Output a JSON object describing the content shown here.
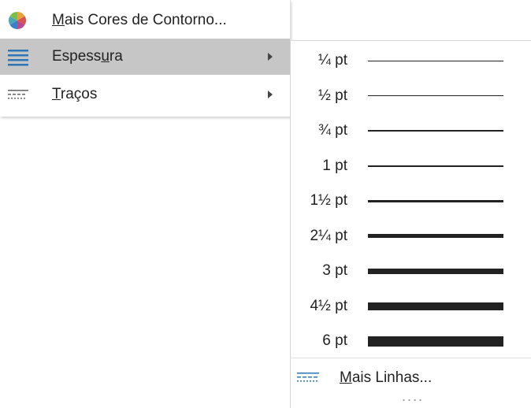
{
  "main_menu": {
    "items": [
      {
        "label": "Mais Cores de Contorno...",
        "icon": "color-wheel-icon",
        "has_submenu": false,
        "highlighted": false
      },
      {
        "label": "Espessura",
        "icon": "line-weight-icon",
        "has_submenu": true,
        "highlighted": true
      },
      {
        "label": "Traços",
        "icon": "dash-type-icon",
        "has_submenu": true,
        "highlighted": false
      }
    ]
  },
  "weight_submenu": {
    "items": [
      {
        "label": "¼ pt",
        "value_pt": 0.25
      },
      {
        "label": "½ pt",
        "value_pt": 0.5
      },
      {
        "label": "¾ pt",
        "value_pt": 0.75
      },
      {
        "label": "1 pt",
        "value_pt": 1
      },
      {
        "label": "1½ pt",
        "value_pt": 1.5
      },
      {
        "label": "2¼ pt",
        "value_pt": 2.25
      },
      {
        "label": "3 pt",
        "value_pt": 3
      },
      {
        "label": "4½ pt",
        "value_pt": 4.5
      },
      {
        "label": "6 pt",
        "value_pt": 6
      }
    ],
    "more_lines_label": "Mais Linhas...",
    "more_lines_icon": "more-lines-icon"
  },
  "colors": {
    "highlight": "#c6c6c6",
    "line": "#222222",
    "icon_blue": "#2e75b6"
  }
}
